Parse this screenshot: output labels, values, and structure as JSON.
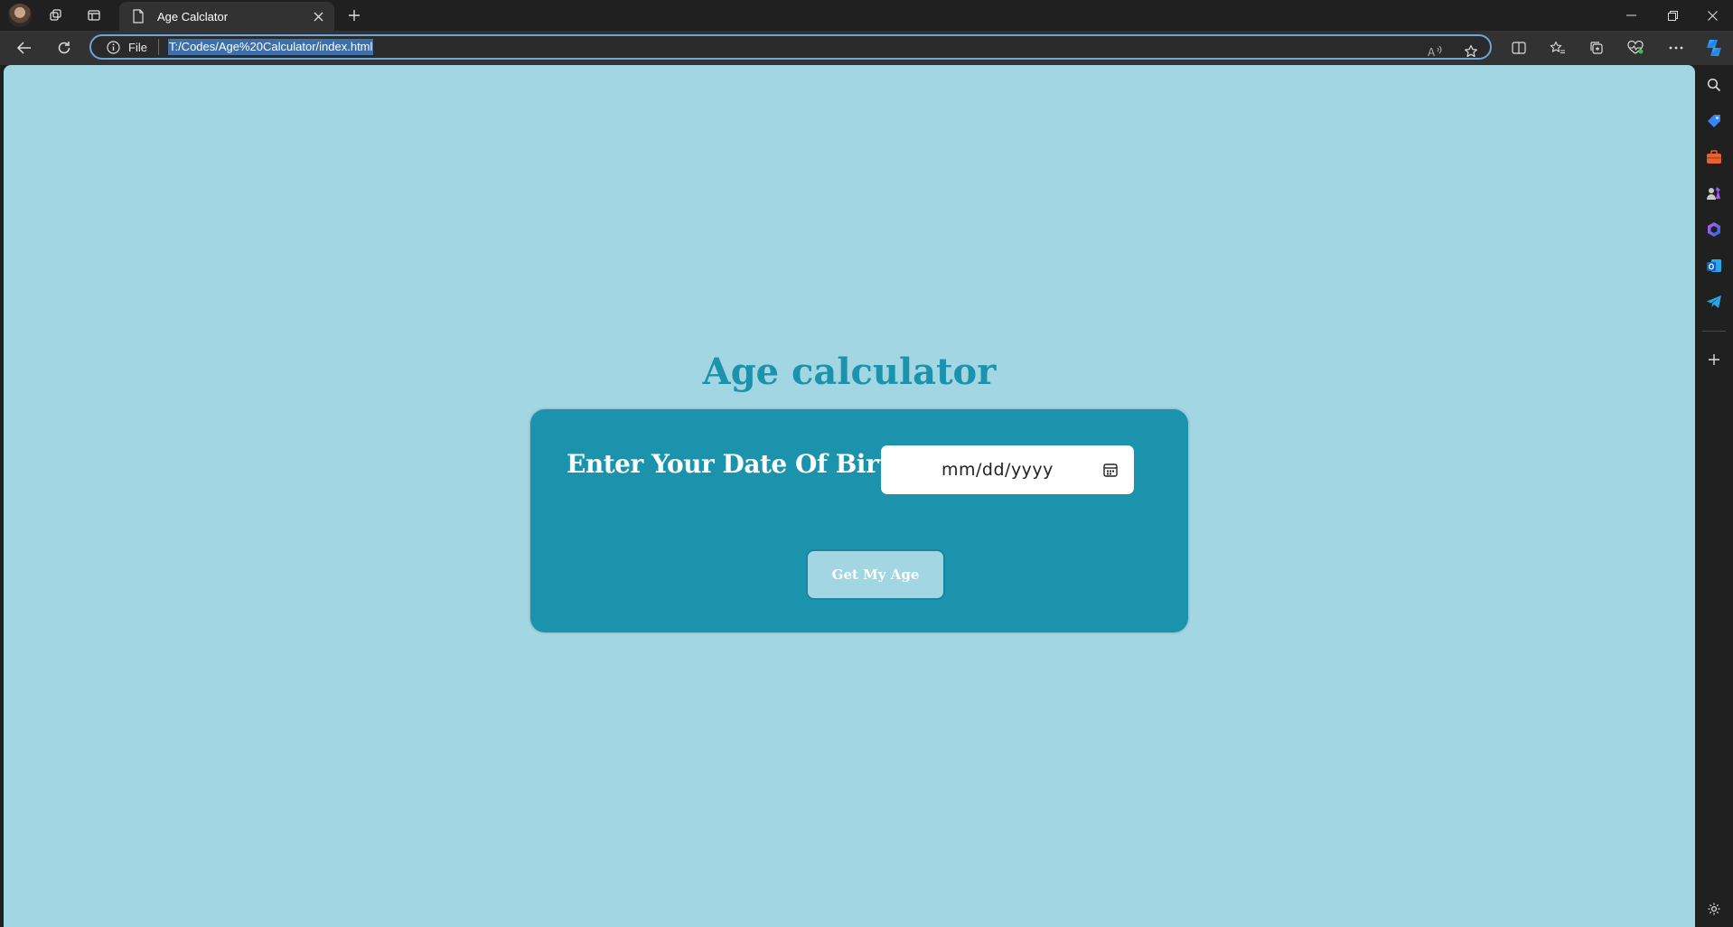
{
  "browser": {
    "tab": {
      "title": "Age Calclator"
    },
    "address": {
      "scheme_label": "File",
      "url": "T:/Codes/Age%20Calculator/index.html"
    }
  },
  "page": {
    "heading": "Age calculator",
    "card": {
      "dob_label": "Enter Your Date Of Birth",
      "date_input": {
        "placeholder": "mm/dd/yyyy"
      },
      "button_label": "Get My Age"
    }
  },
  "colors": {
    "page_background": "#a3d6e3",
    "accent": "#1b93ad",
    "button_background": "#a3d6e3",
    "chrome_dark": "#202020",
    "chrome_toolbar": "#323232"
  },
  "icons": {
    "tabbar": [
      "profile-avatar",
      "workspaces-icon",
      "tab-actions-icon",
      "page-icon",
      "close-icon",
      "new-tab-icon"
    ],
    "window": [
      "minimize-icon",
      "restore-icon",
      "close-window-icon"
    ],
    "toolbar": [
      "back-icon",
      "refresh-icon",
      "info-icon",
      "read-aloud-icon",
      "favorite-star-icon",
      "split-screen-icon",
      "favorites-icon",
      "collections-icon",
      "browser-essentials-icon",
      "more-icon",
      "copilot-icon"
    ],
    "sidebar": [
      "search-icon",
      "shopping-tag-icon",
      "tools-icon",
      "games-icon",
      "office-icon",
      "outlook-icon",
      "telegram-icon",
      "add-icon",
      "settings-icon"
    ]
  }
}
